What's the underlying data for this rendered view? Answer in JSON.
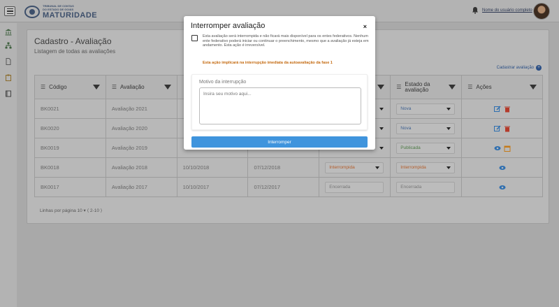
{
  "header": {
    "logo_line1": "TRIBUNAL DE CONTAS",
    "logo_line2": "DO ESTADO DE GOIÁS",
    "logo_main": "MATURIDADE",
    "user_link": "Nome do usuário completo"
  },
  "page": {
    "title": "Cadastro -  Avaliação",
    "subtitle": "Listagem de todas as avaliações",
    "add_link": "Cadastrar avaliação"
  },
  "table": {
    "columns": [
      "Código",
      "Avaliação",
      "",
      "",
      "",
      "Estado da avaliação",
      "Ações"
    ],
    "rows": [
      {
        "codigo": "BK0021",
        "avaliacao": "Avaliação 2021",
        "d1": "",
        "d2": "",
        "fase": "",
        "estado": "Nova",
        "acoes": "edit-delete"
      },
      {
        "codigo": "BK0020",
        "avaliacao": "Avaliação 2020",
        "d1": "",
        "d2": "",
        "fase": "",
        "estado": "Nova",
        "acoes": "edit-delete"
      },
      {
        "codigo": "BK0019",
        "avaliacao": "Avaliação 2019",
        "d1": "",
        "d2": "",
        "fase": "",
        "estado": "Publicada",
        "acoes": "view-calendar"
      },
      {
        "codigo": "BK0018",
        "avaliacao": "Avaliação 2018",
        "d1": "10/10/2018",
        "d2": "07/12/2018",
        "fase": "Interrompida",
        "estado": "Interrompida",
        "acoes": "view"
      },
      {
        "codigo": "BK0017",
        "avaliacao": "Avaliação 2017",
        "d1": "10/10/2017",
        "d2": "07/12/2017",
        "fase": "Encerrada",
        "estado": "Encerrada",
        "acoes": "view"
      }
    ],
    "pager": "Linhas por página  10 ▾  ⟨  2-10  ⟩"
  },
  "modal": {
    "title": "Interromper avaliação",
    "close": "×",
    "checkbox_text": "Esta avaliação será interrompida e não ficará mais disponível para os entes federativos. Nenhum ente federativo poderá iniciar ou continuar o preenchimento, mesmo que a avaliação já esteja em andamento. Esta ação é irreversível.",
    "warning": "Esta ação implicará na interrupção imediata da autoavaliação da fase 1",
    "reason_label": "Motivo da interrupção",
    "reason_placeholder": "Insira seu motivo aqui...",
    "reason_value": "",
    "button": "Interromper"
  },
  "colors": {
    "primary": "#3f94dd",
    "warning": "#c46a10",
    "brand": "#3d4f6b"
  }
}
